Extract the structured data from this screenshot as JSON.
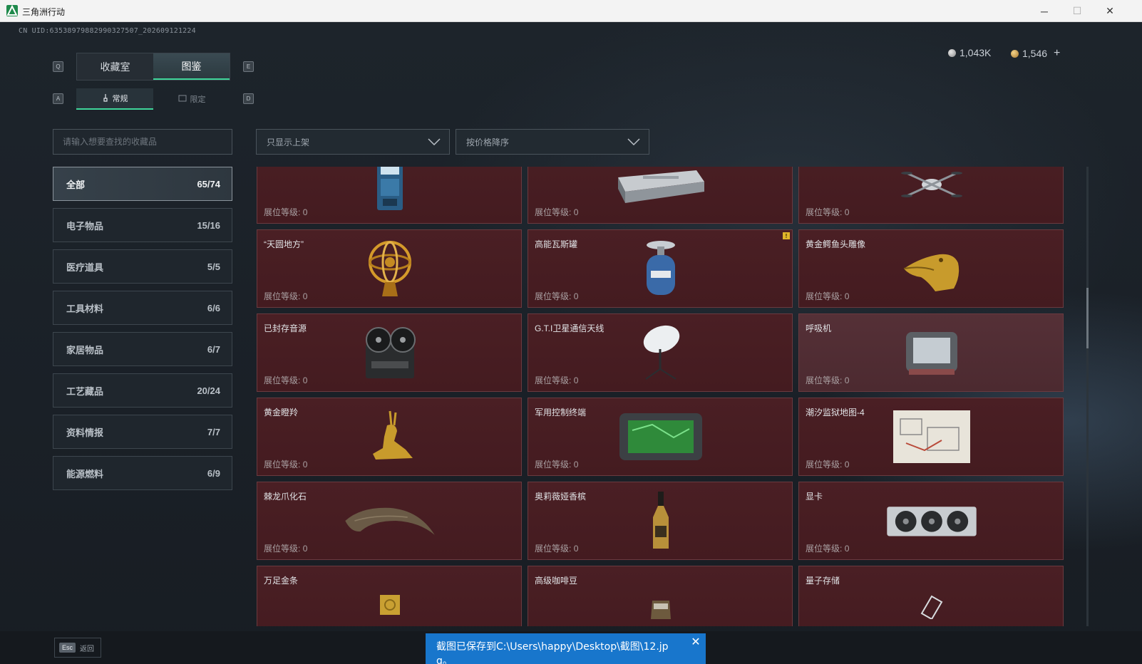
{
  "window": {
    "title": "三角洲行动",
    "minimize": "─",
    "maximize": "☐",
    "close": "✕"
  },
  "uid": "CN UID:6353897988299032750​7_202609121224",
  "currency": {
    "silver": "1,043K",
    "gold": "1,546",
    "plus": "+"
  },
  "keys": {
    "q": "Q",
    "e": "E",
    "a": "A",
    "d": "D"
  },
  "tabs": [
    {
      "label": "收藏室"
    },
    {
      "label": "图鉴"
    }
  ],
  "subtabs": [
    {
      "label": "常规"
    },
    {
      "label": "限定"
    }
  ],
  "search": {
    "placeholder": "请输入想要查找的收藏品"
  },
  "filters": {
    "shelf": "只显示上架",
    "sort": "按价格降序"
  },
  "categories": [
    {
      "label": "全部",
      "count": "65/74"
    },
    {
      "label": "电子物品",
      "count": "15/16"
    },
    {
      "label": "医疗道具",
      "count": "5/5"
    },
    {
      "label": "工具材料",
      "count": "6/6"
    },
    {
      "label": "家居物品",
      "count": "6/7"
    },
    {
      "label": "工艺藏品",
      "count": "20/24"
    },
    {
      "label": "资料情报",
      "count": "7/7"
    },
    {
      "label": "能源燃料",
      "count": "6/9"
    }
  ],
  "level_label": "展位等级:",
  "items": [
    {
      "name": "",
      "level": "0",
      "icon": "arcade-machine-icon"
    },
    {
      "name": "",
      "level": "0",
      "icon": "server-case-icon"
    },
    {
      "name": "",
      "level": "0",
      "icon": "drone-icon"
    },
    {
      "name": "“天圆地方”",
      "level": "0",
      "icon": "armillary-sphere-icon"
    },
    {
      "name": "高能瓦斯罐",
      "level": "0",
      "icon": "gas-canister-icon",
      "warning": "!"
    },
    {
      "name": "黄金鳄鱼头雕像",
      "level": "0",
      "icon": "gold-crocodile-icon"
    },
    {
      "name": "已封存音源",
      "level": "0",
      "icon": "reel-recorder-icon"
    },
    {
      "name": "G.T.I卫星通信天线",
      "level": "0",
      "icon": "satellite-dish-icon"
    },
    {
      "name": "呼吸机",
      "level": "0",
      "icon": "ventilator-icon"
    },
    {
      "name": "黄金瞪羚",
      "level": "0",
      "icon": "gold-gazelle-icon"
    },
    {
      "name": "军用控制终端",
      "level": "0",
      "icon": "control-terminal-icon"
    },
    {
      "name": "潮汐监狱地图-4",
      "level": "0",
      "icon": "map-icon"
    },
    {
      "name": "棘龙爪化石",
      "level": "0",
      "icon": "claw-fossil-icon"
    },
    {
      "name": "奥莉薇娅香槟",
      "level": "0",
      "icon": "champagne-icon"
    },
    {
      "name": "显卡",
      "level": "0",
      "icon": "gpu-icon"
    },
    {
      "name": "万足金条",
      "level": "",
      "icon": "gold-bar-icon"
    },
    {
      "name": "高级咖啡豆",
      "level": "",
      "icon": "coffee-bag-icon"
    },
    {
      "name": "量子存储",
      "level": "",
      "icon": "quantum-storage-icon"
    }
  ],
  "esc": {
    "key": "Esc",
    "label": "返回"
  },
  "toast": {
    "message": "截图已保存到C:\\Users\\happy\\Desktop\\截图\\12.jpg。",
    "close": "✕"
  }
}
